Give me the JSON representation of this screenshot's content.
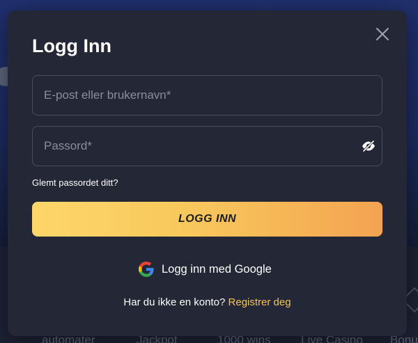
{
  "background": {
    "nav_items": [
      "automater",
      "Jackpot",
      "1000 wins",
      "Live Casino",
      "Bonu"
    ]
  },
  "modal": {
    "title": "Logg Inn",
    "close_icon": "close-icon",
    "email": {
      "placeholder": "E-post eller brukernavn*",
      "value": ""
    },
    "password": {
      "placeholder": "Passord*",
      "value": "",
      "toggle_icon": "eye-slash-icon"
    },
    "forgot_password": "Glemt passordet ditt?",
    "login_button": "LOGG INN",
    "google": {
      "label": "Logg inn med Google",
      "icon": "google-icon"
    },
    "signup": {
      "prompt": "Har du ikke en konto?",
      "link": "Registrer deg"
    }
  },
  "colors": {
    "accent": "#f6c453",
    "button_gradient_start": "#fdd66a",
    "button_gradient_end": "#f3a351",
    "modal_bg": "#242735"
  }
}
